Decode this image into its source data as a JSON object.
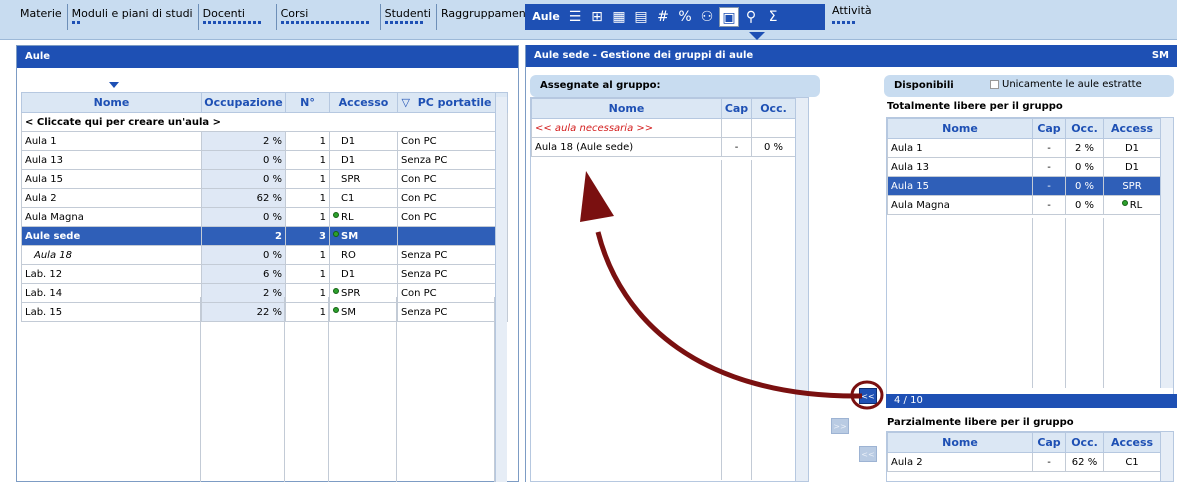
{
  "menu": {
    "items": [
      "Materie",
      "Moduli e piani di studi",
      "Docenti",
      "Corsi",
      "Studenti",
      "Raggruppamenti"
    ],
    "active": "Aule",
    "activity": "Attività"
  },
  "left_panel": {
    "title": "Aule",
    "columns": [
      "Nome",
      "Occupazione",
      "N°",
      "Accesso",
      "PC portatile"
    ],
    "create_row": "< Cliccate qui per creare un'aula >",
    "rows": [
      {
        "name": "Aula 1",
        "occ": "2 %",
        "n": "1",
        "access": "D1",
        "pc": "Con PC",
        "dot": false
      },
      {
        "name": "Aula 13",
        "occ": "0 %",
        "n": "1",
        "access": "D1",
        "pc": "Senza PC",
        "dot": false
      },
      {
        "name": "Aula 15",
        "occ": "0 %",
        "n": "1",
        "access": "SPR",
        "pc": "Con PC",
        "dot": false
      },
      {
        "name": "Aula 2",
        "occ": "62 %",
        "n": "1",
        "access": "C1",
        "pc": "Con PC",
        "dot": false
      },
      {
        "name": "Aula Magna",
        "occ": "0 %",
        "n": "1",
        "access": "RL",
        "pc": "Con PC",
        "dot": true
      },
      {
        "name": "Aule sede",
        "occ": "2",
        "n": "3",
        "access": "SM",
        "pc": "",
        "dot": true,
        "selected": true
      },
      {
        "name": "Aula 18",
        "occ": "0 %",
        "n": "1",
        "access": "RO",
        "pc": "Senza PC",
        "dot": false,
        "italic": true
      },
      {
        "name": "Lab. 12",
        "occ": "6 %",
        "n": "1",
        "access": "D1",
        "pc": "Senza PC",
        "dot": false
      },
      {
        "name": "Lab. 14",
        "occ": "2 %",
        "n": "1",
        "access": "SPR",
        "pc": "Con PC",
        "dot": true
      },
      {
        "name": "Lab. 15",
        "occ": "22 %",
        "n": "1",
        "access": "SM",
        "pc": "Senza PC",
        "dot": true
      }
    ]
  },
  "right_panel": {
    "title": "Aule sede - Gestione dei gruppi di aule",
    "title_code": "SM",
    "assigned_header": "Assegnate al gruppo:",
    "assigned_columns": [
      "Nome",
      "Cap",
      "Occ."
    ],
    "assigned_needed": "<< aula necessaria >>",
    "assigned_rows": [
      {
        "name": "Aula 18 (Aule sede)",
        "cap": "-",
        "occ": "0 %"
      }
    ],
    "available_header": "Disponibili",
    "only_extracted_label": "Unicamente le aule estratte",
    "totally_free_label": "Totalmente libere per il gruppo",
    "avail_columns": [
      "Nome",
      "Cap",
      "Occ.",
      "Access"
    ],
    "totally_free_rows": [
      {
        "name": "Aula 1",
        "cap": "-",
        "occ": "2 %",
        "access": "D1",
        "dot": false
      },
      {
        "name": "Aula 13",
        "cap": "-",
        "occ": "0 %",
        "access": "D1",
        "dot": false
      },
      {
        "name": "Aula 15",
        "cap": "-",
        "occ": "0 %",
        "access": "SPR",
        "dot": false,
        "selected": true
      },
      {
        "name": "Aula Magna",
        "cap": "-",
        "occ": "0 %",
        "access": "RL",
        "dot": true
      }
    ],
    "count": "4 / 10",
    "partially_free_label": "Parzialmente libere per il gruppo",
    "partially_free_rows": [
      {
        "name": "Aula 2",
        "cap": "-",
        "occ": "62 %",
        "access": "C1"
      }
    ],
    "move_left_btn": "<<",
    "move_right_btn": ">>"
  },
  "colors": {
    "accent": "#1e50b4",
    "arrow": "#7a1010"
  }
}
